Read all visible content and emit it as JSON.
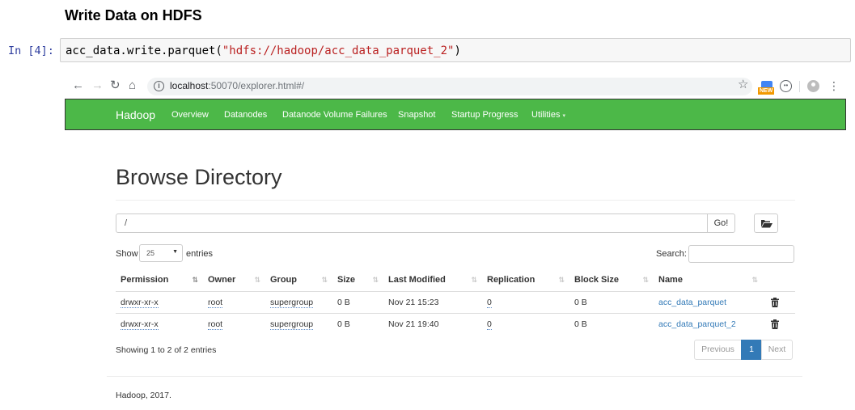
{
  "notebook": {
    "heading": "Write Data on HDFS",
    "prompt": "In [4]:",
    "code_prefix": "acc_data.write.parquet(",
    "code_string": "\"hdfs://hadoop/acc_data_parquet_2\"",
    "code_suffix": ")"
  },
  "browser": {
    "url_host": "localhost",
    "url_rest": ":50070/explorer.html#/",
    "icons": [
      "back-arrow-icon",
      "forward-arrow-icon",
      "reload-icon",
      "home-icon",
      "info-icon",
      "star-icon",
      "new-extension-icon",
      "extension-icon",
      "account-icon",
      "menu-icon"
    ],
    "ext_badge": "NEW"
  },
  "navbar": {
    "brand": "Hadoop",
    "items": [
      "Overview",
      "Datanodes",
      "Datanode Volume Failures",
      "Snapshot",
      "Startup Progress",
      "Utilities"
    ],
    "color": "#4cb848"
  },
  "page": {
    "title": "Browse Directory",
    "path_value": "/",
    "go_label": "Go!",
    "show_label": "Show",
    "entries_value": "25",
    "entries_label": "entries",
    "search_label": "Search:",
    "columns": [
      "Permission",
      "Owner",
      "Group",
      "Size",
      "Last Modified",
      "Replication",
      "Block Size",
      "Name"
    ],
    "rows": [
      {
        "permission": "drwxr-xr-x",
        "owner": "root",
        "group": "supergroup",
        "size": "0 B",
        "modified": "Nov 21 15:23",
        "replication": "0",
        "block_size": "0 B",
        "name": "acc_data_parquet"
      },
      {
        "permission": "drwxr-xr-x",
        "owner": "root",
        "group": "supergroup",
        "size": "0 B",
        "modified": "Nov 21 19:40",
        "replication": "0",
        "block_size": "0 B",
        "name": "acc_data_parquet_2"
      }
    ],
    "showing_text": "Showing 1 to 2 of 2 entries",
    "pager": {
      "previous": "Previous",
      "current": "1",
      "next": "Next"
    },
    "footer": "Hadoop, 2017.",
    "link_color": "#337ab7"
  }
}
